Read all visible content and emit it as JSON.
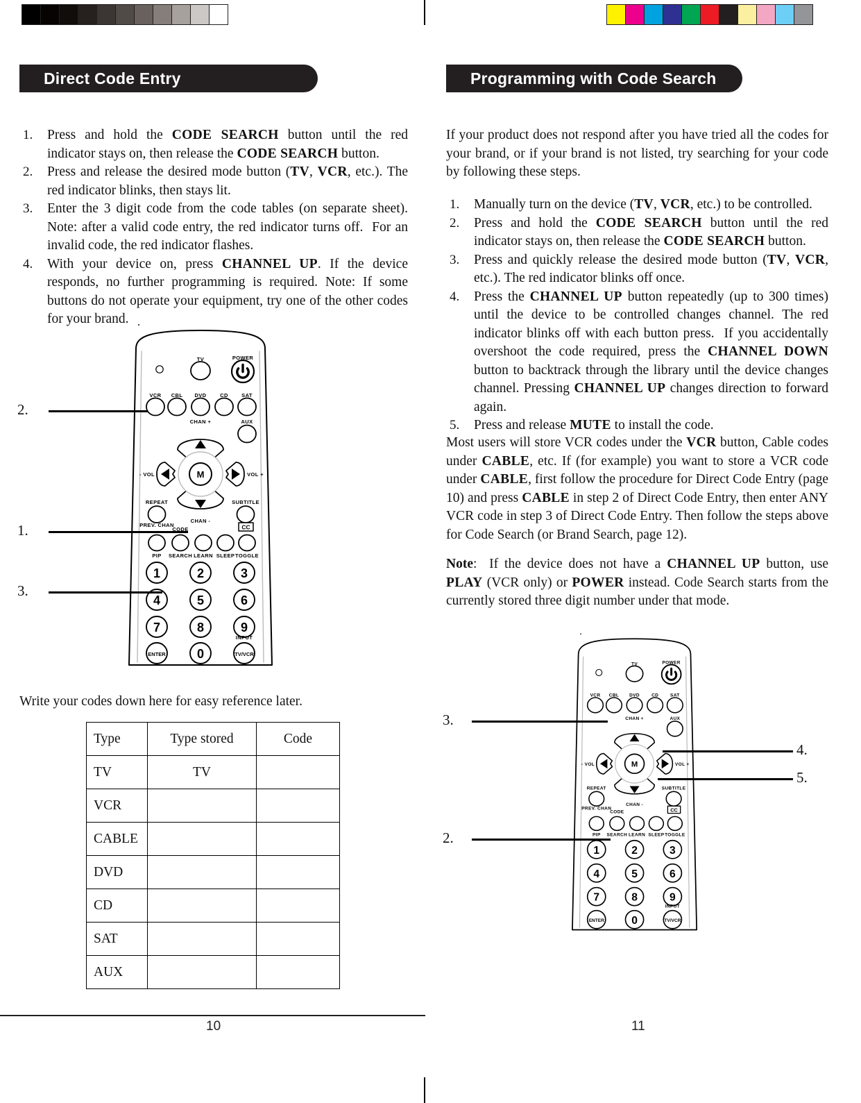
{
  "document": {
    "type": "universal-remote-manual-spread",
    "left_page_number": "10",
    "right_page_number": "11"
  },
  "calibration": {
    "grayscale_label": "grayscale-calibration-bar",
    "grayscale_swatches": [
      "#000000",
      "#050403",
      "#110d0a",
      "#26211f",
      "#3b3533",
      "#514b47",
      "#68615d",
      "#857e7a",
      "#a6a19d",
      "#cbc8c5",
      "#ffffff"
    ],
    "color_label": "color-calibration-bar",
    "color_swatches": [
      "#fff200",
      "#ec008c",
      "#00a3e0",
      "#2e3192",
      "#00a651",
      "#ed1c24",
      "#231f20",
      "#fbf0a0",
      "#f4a7c3",
      "#6dcff6",
      "#939598"
    ]
  },
  "left_page": {
    "header": "Direct Code Entry",
    "steps": [
      {
        "num": "1.",
        "html": "Press and hold the <span class='sc'>CODE SEARCH</span> button until the red indicator stays on, then release the <span class='sc'>CODE SEARCH</span> button."
      },
      {
        "num": "2.",
        "html": "Press and release the desired mode button (<span class='sc'>TV</span>, <span class='sc'>VCR</span>, etc.). The red indicator blinks, then stays lit."
      },
      {
        "num": "3.",
        "html": "Enter the 3 digit code from the code tables (on separate sheet). Note: after a valid code entry, the red indicator turns off.&nbsp; For an invalid code, the red indicator flashes."
      },
      {
        "num": "4.",
        "html": "With your device on, press <span class='sc'>CHANNEL UP</span>. If the device responds, no further programming is required. Note: If some buttons do not operate your equipment, try one of the other codes for your brand."
      }
    ],
    "callouts": [
      {
        "label": "2.",
        "target": "vcr-mode-button"
      },
      {
        "label": "1.",
        "target": "code-search-button"
      },
      {
        "label": "3.",
        "target": "number-keypad"
      }
    ],
    "table_intro": "Write your codes down here for easy reference later.",
    "table": {
      "headers": [
        "Type",
        "Type  stored",
        "Code"
      ],
      "rows": [
        [
          "TV",
          "TV",
          ""
        ],
        [
          "VCR",
          "",
          ""
        ],
        [
          "CABLE",
          "",
          ""
        ],
        [
          "DVD",
          "",
          ""
        ],
        [
          "CD",
          "",
          ""
        ],
        [
          "SAT",
          "",
          ""
        ],
        [
          "AUX",
          "",
          ""
        ]
      ]
    }
  },
  "right_page": {
    "header": "Programming with Code Search",
    "intro": "If your product does not respond after you have tried all the codes for your brand, or if your brand is not listed, try searching for your code by following these steps.",
    "steps": [
      {
        "num": "1.",
        "html": "Manually turn on the device (<span class='sc'>TV</span>, <span class='sc'>VCR</span>, etc.) to be controlled."
      },
      {
        "num": "2.",
        "html": "Press and hold the <span class='sc'>CODE SEARCH</span> button until the red indicator stays on, then release the <span class='sc'>CODE SEARCH</span> button."
      },
      {
        "num": "3.",
        "html": "Press and quickly release the desired mode button (<span class='sc'>TV</span>, <span class='sc'>VCR</span>, etc.). The red indicator blinks off once."
      },
      {
        "num": "4.",
        "html": "Press the <span class='sc'>CHANNEL UP</span> button repeatedly (up to 300 times) until the device to be controlled changes channel. The red indicator blinks off with each button press.&nbsp; If you accidentally overshoot the code required, press the <span class='sc'>CHANNEL DOWN</span> button to backtrack through the library until the device changes channel. Pressing <span class='sc'>CHANNEL UP</span> changes direction to forward again."
      },
      {
        "num": "5.",
        "html": "Press and release <span class='sc'>MUTE</span> to install the code."
      }
    ],
    "paragraph_store": "Most users will store VCR codes under the <span class='sc'>VCR</span> button, Cable codes under <span class='sc'>CABLE</span>, etc. If (for example) you want to store a VCR code under <span class='sc'>CABLE</span>, first follow the procedure for Direct Code Entry (page 10) and press <span class='sc'>CABLE</span> in step 2 of Direct Code Entry, then enter ANY VCR code in step 3 of Direct Code Entry. Then follow the steps above for Code Search (or Brand Search, page 12).",
    "paragraph_note": "<b class='nb'>Note</b>:&nbsp; If the device does not have a <span class='sc'>CHANNEL UP</span> button, use <span class='sc'>PLAY</span> (VCR only) or <span class='sc'>POWER</span> instead. Code Search starts from the currently stored three digit number under that mode.",
    "callouts": [
      {
        "label": "3.",
        "target": "vcr-mode-button"
      },
      {
        "label": "4.",
        "target": "channel-up-button"
      },
      {
        "label": "5.",
        "target": "mute-button"
      },
      {
        "label": "2.",
        "target": "code-search-button"
      }
    ]
  },
  "remote": {
    "indicator_label": "",
    "buttons": {
      "tv": "TV",
      "power": "POWER",
      "vcr": "VCR",
      "cbl": "CBL",
      "dvd": "DVD",
      "cd": "CD",
      "sat": "SAT",
      "aux": "AUX",
      "chan_up": "CHAN +",
      "chan_down": "CHAN -",
      "vol_down": "- VOL",
      "vol_up": "VOL +",
      "mute": "M",
      "repeat": "REPEAT",
      "prev_chan": "PREV. CHAN",
      "subtitle": "SUBTITLE",
      "cc": "CC",
      "pip": "PIP",
      "code": "CODE",
      "search": "SEARCH",
      "learn": "LEARN",
      "sleep": "SLEEP",
      "toggle": "TOGGLE",
      "enter": "ENTER",
      "input": "INPUT",
      "tvvcr": "TV/VCR",
      "keys": [
        "1",
        "2",
        "3",
        "4",
        "5",
        "6",
        "7",
        "8",
        "9",
        "0"
      ]
    }
  }
}
